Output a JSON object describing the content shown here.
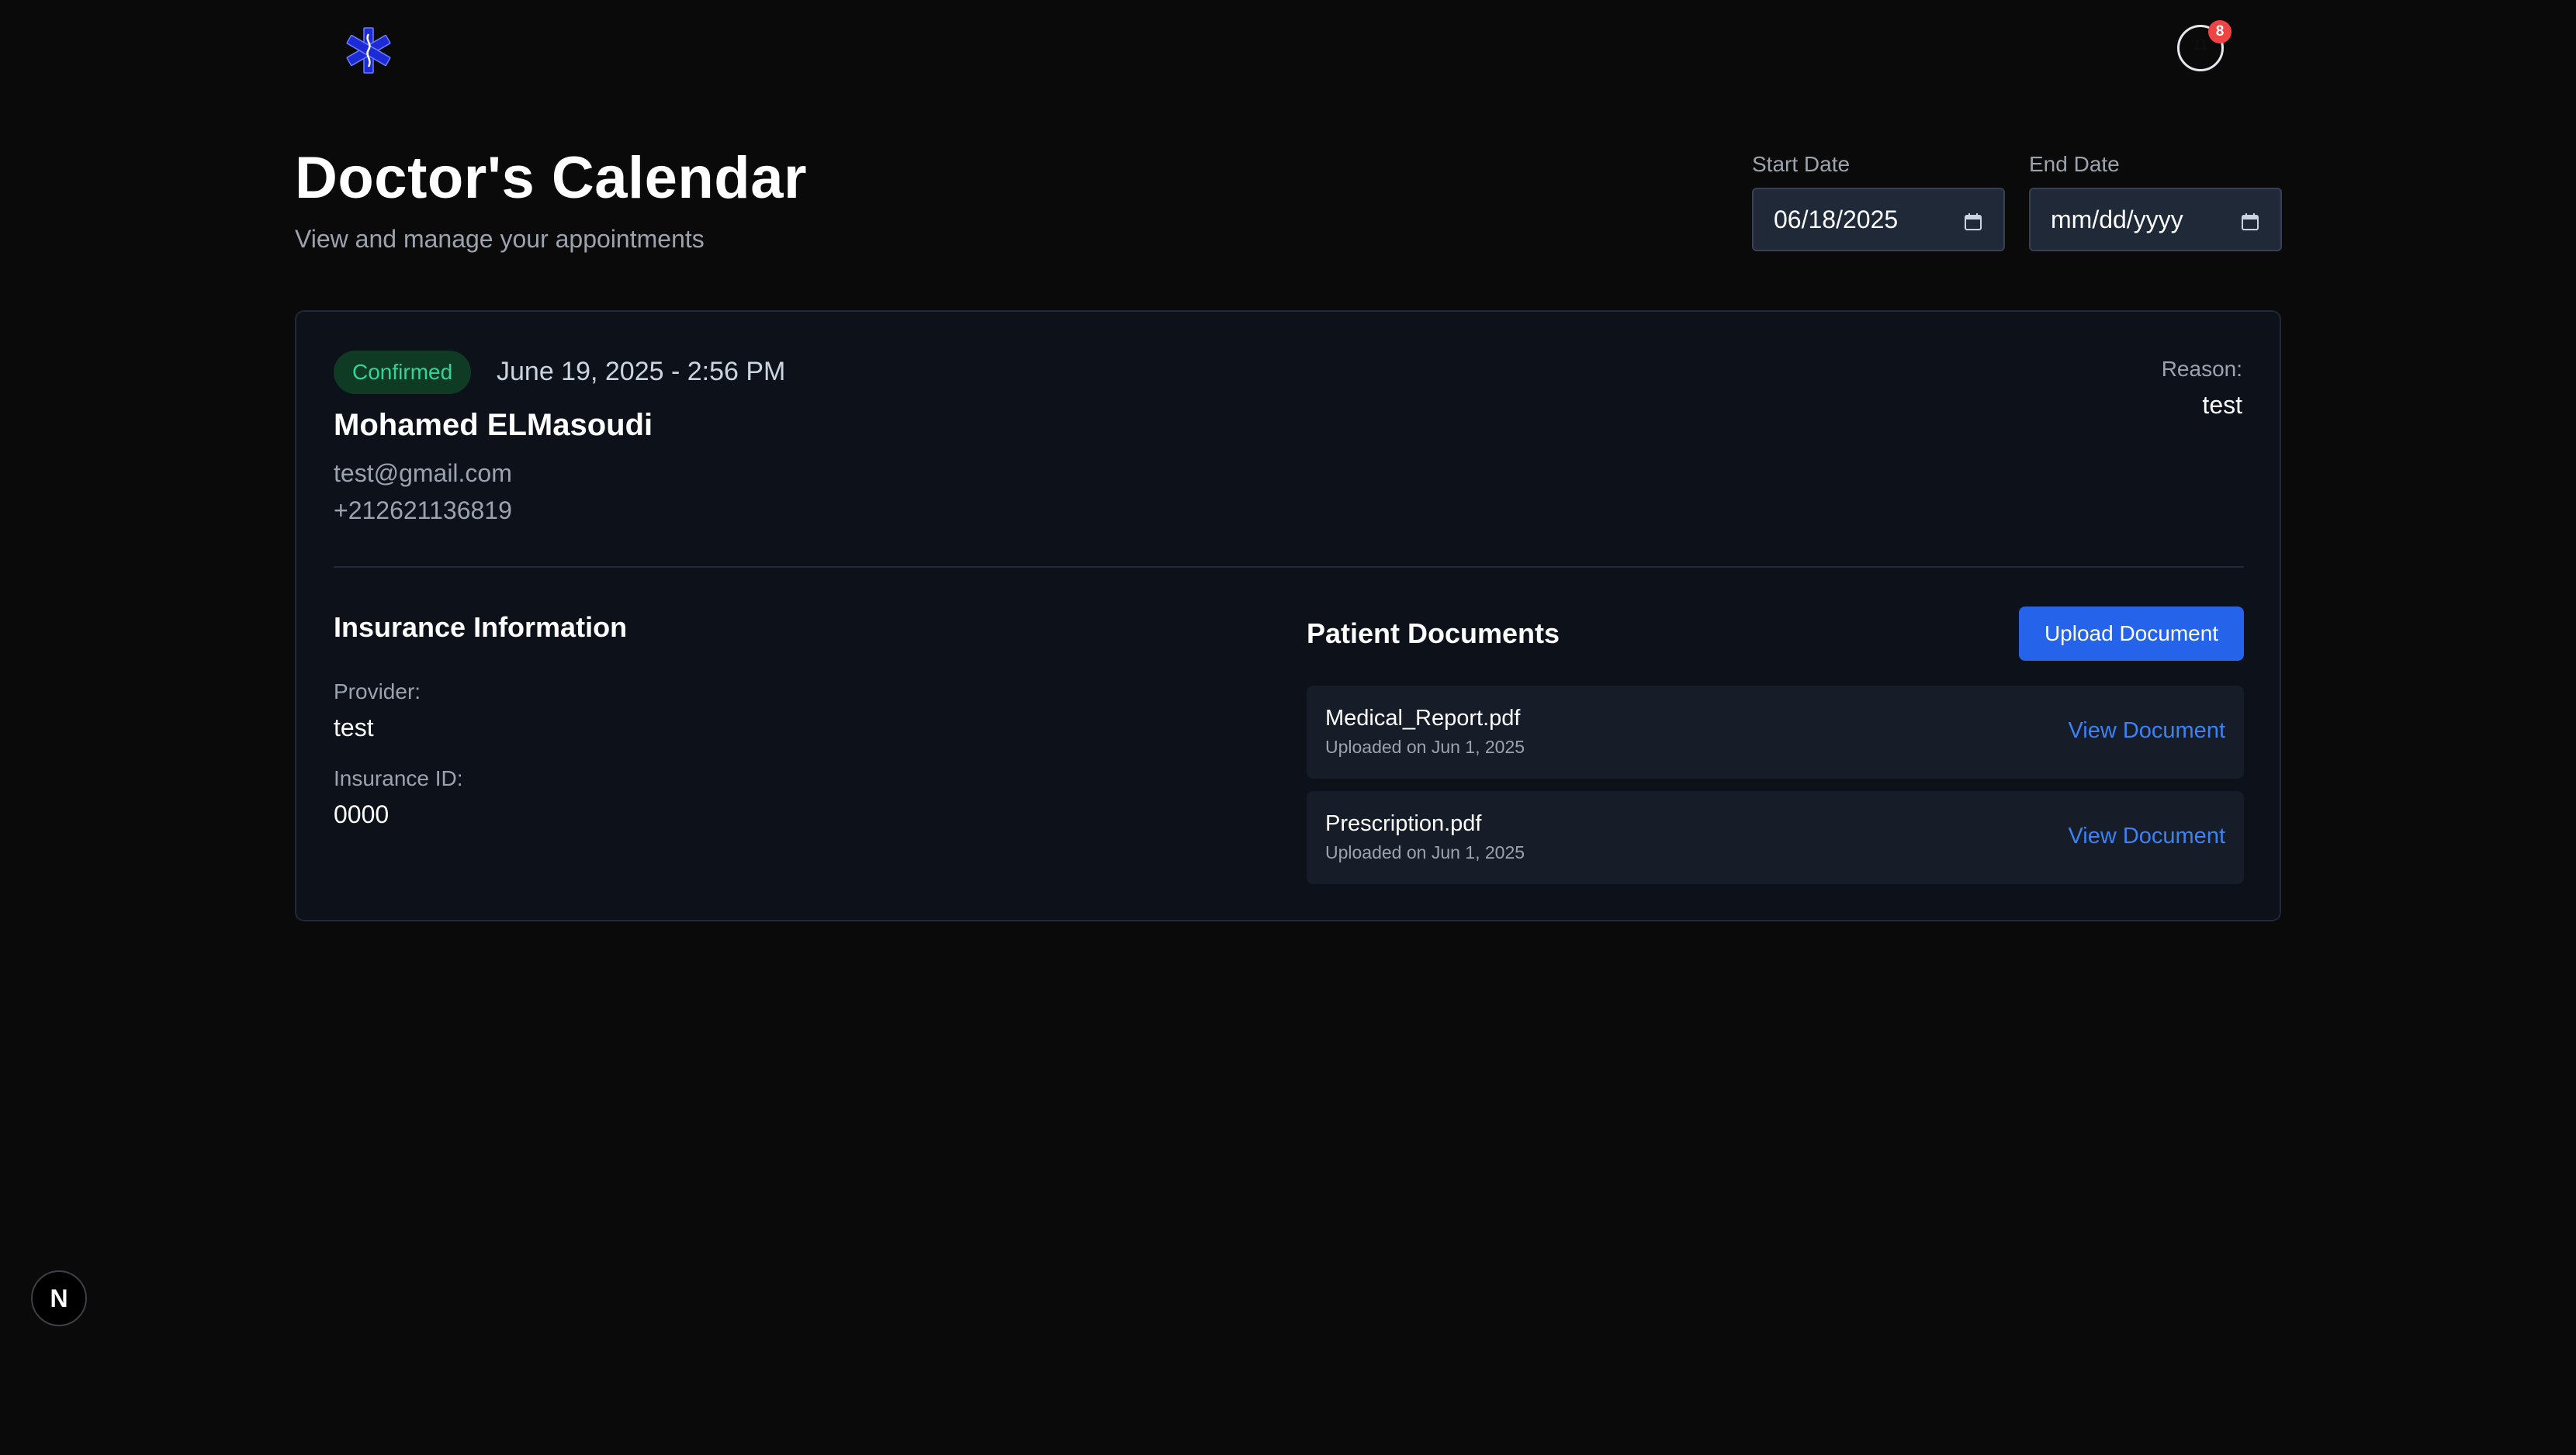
{
  "header": {
    "logo_icon": "medical-star-of-life-icon",
    "notification_icon": "bell-icon",
    "notification_count": "8",
    "logo_color": "#1d2bd6",
    "badge_color": "#ef4444"
  },
  "page": {
    "title": "Doctor's Calendar",
    "subtitle": "View and manage your appointments"
  },
  "filters": {
    "start_label": "Start Date",
    "start_value": "06/18/2025",
    "end_label": "End Date",
    "end_placeholder": "mm/dd/yyyy"
  },
  "appointment": {
    "status": "Confirmed",
    "datetime": "June 19, 2025 - 2:56 PM",
    "patient_name": "Mohamed ELMasoudi",
    "email": "test@gmail.com",
    "phone": "+212621136819",
    "reason_label": "Reason:",
    "reason_value": "test",
    "status_color": "#34d399"
  },
  "insurance": {
    "title": "Insurance Information",
    "provider_label": "Provider:",
    "provider_value": "test",
    "id_label": "Insurance ID:",
    "id_value": "0000"
  },
  "documents": {
    "title": "Patient Documents",
    "upload_label": "Upload Document",
    "items": [
      {
        "name": "Medical_Report.pdf",
        "uploaded": "Uploaded on Jun 1, 2025",
        "action": "View Document"
      },
      {
        "name": "Prescription.pdf",
        "uploaded": "Uploaded on Jun 1, 2025",
        "action": "View Document"
      }
    ],
    "accent_color": "#2563eb"
  },
  "dev_indicator": {
    "label": "N"
  }
}
